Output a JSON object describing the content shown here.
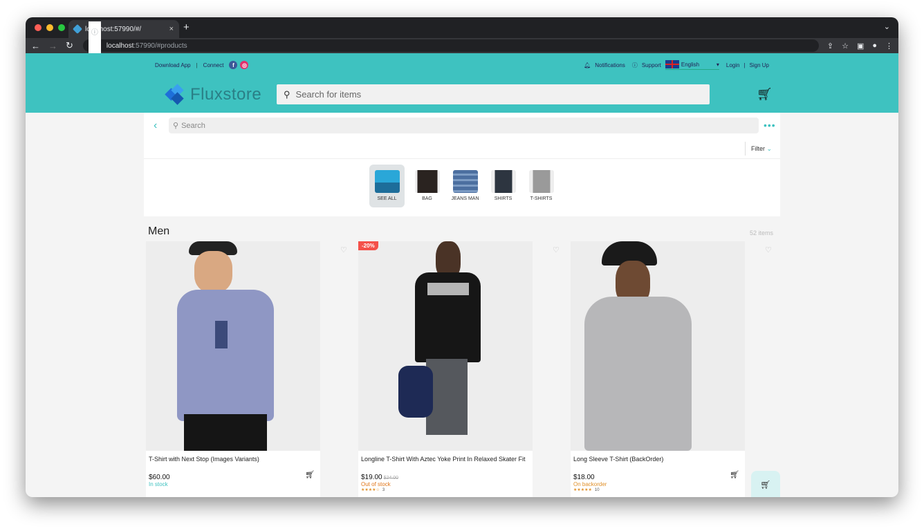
{
  "browser": {
    "tab_title": "localhost:57990/#/",
    "url_host": "localhost",
    "url_rest": ":57990/#products",
    "new_tab": "+",
    "tab_close": "×"
  },
  "header": {
    "download_app": "Download App",
    "connect": "Connect",
    "notifications": "Notifications",
    "support": "Support",
    "language": "English",
    "login": "Login",
    "signup": "Sign Up",
    "brand": "Fluxstore",
    "search_placeholder": "Search for items"
  },
  "catalog": {
    "search_placeholder": "Search",
    "filter_label": "Filter",
    "categories": [
      {
        "label": "SEE ALL",
        "selected": true
      },
      {
        "label": "BAG"
      },
      {
        "label": "JEANS MAN"
      },
      {
        "label": "SHIRTS"
      },
      {
        "label": "T-SHIRTS"
      }
    ],
    "section_title": "Men",
    "item_count": "52 items"
  },
  "products": [
    {
      "name": "T-Shirt with Next Stop (Images Variants)",
      "price": "$60.00",
      "old_price": "",
      "stock": "In stock",
      "stock_color": "#3ec2c0",
      "badge": "",
      "stars": "",
      "reviews": ""
    },
    {
      "name": "Longline T-Shirt With Aztec Yoke Print In Relaxed Skater Fit",
      "price": "$19.00",
      "old_price": "$24.00",
      "stock": "Out of stock",
      "stock_color": "#e0761a",
      "badge": "-20%",
      "stars": "★★★★☆",
      "reviews": "3"
    },
    {
      "name": "Long Sleeve T-Shirt (BackOrder)",
      "price": "$18.00",
      "old_price": "",
      "stock": "On backorder",
      "stock_color": "#e0902a",
      "badge": "",
      "stars": "★★★★★",
      "reviews": "10"
    }
  ],
  "colors": {
    "accent": "#3ec2c0",
    "sale": "#f4514a"
  }
}
